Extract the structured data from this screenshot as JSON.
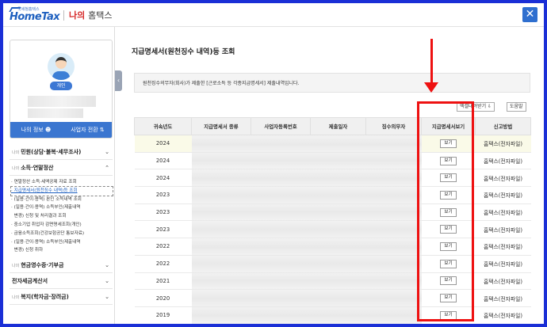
{
  "header": {
    "logo_small": "국세청홈택스",
    "logo_text": "HomeTax",
    "brand_red": "나의",
    "brand_dark": "홈택스",
    "close_symbol": "✕"
  },
  "profile": {
    "badge": "개인",
    "my_info": "나의 정보",
    "switch_btn": "사업자 전환"
  },
  "menu": {
    "sections": [
      {
        "prefix": "나의",
        "label": "민원(상담·불복·세무조사)"
      },
      {
        "prefix": "나의",
        "label": "소득·연말정산"
      },
      {
        "prefix": "나의",
        "label": "현금영수증·기부금"
      },
      {
        "prefix": "",
        "label": "전자세금계산서"
      },
      {
        "prefix": "나의",
        "label": "복지(학자금·장려금)"
      }
    ],
    "subitems": [
      "연말정산 소득·세액공제 자료 조회",
      "지급명세서(원천징수 내역)등 조회",
      "(일용·간이·용역) 본인 소득내역 조회",
      "(일용·간이·용역) 소득부인(제출내역",
      "변경) 신청 및 처리결과 조회",
      "중소기업 취업자 감면명세조회(개인)",
      "금융소득조회(건강보험공단 통보자료)",
      "(일용·간이·용역) 소득부인(제출내역",
      "변경) 신청 취하"
    ]
  },
  "main": {
    "title": "지급명세서(원천징수 내역)등 조회",
    "info": "원천징수의무자(회사)가 제출한 [근로소득 등 각종지급명세서] 제출내역입니다.",
    "tool_print": "엑셀내려받기",
    "tool_help": "도움말"
  },
  "table": {
    "headers": [
      "귀속년도",
      "지급명세서 종류",
      "사업자등록번호",
      "제출일자",
      "징수의무자",
      "지급명세서보기",
      "신고방법"
    ],
    "view_label": "보기",
    "rows": [
      {
        "year": "2024",
        "method": "홈택스(전자파일)"
      },
      {
        "year": "2024",
        "method": "홈택스(전자파일)"
      },
      {
        "year": "2024",
        "method": "홈택스(전자파일)"
      },
      {
        "year": "2023",
        "method": "홈택스(전자파일)"
      },
      {
        "year": "2023",
        "method": "홈택스(전자파일)"
      },
      {
        "year": "2023",
        "method": "홈택스(전자파일)"
      },
      {
        "year": "2022",
        "method": "홈택스(전자파일)"
      },
      {
        "year": "2022",
        "method": "홈택스(전자파일)"
      },
      {
        "year": "2021",
        "method": "홈택스(전자파일)"
      },
      {
        "year": "2020",
        "method": "홈택스(전자파일)"
      },
      {
        "year": "2019",
        "method": "홈택스(전자파일)"
      }
    ]
  },
  "colors": {
    "accent": "#1d5fbf",
    "highlight": "#e11111",
    "frame": "#1a2fd6"
  }
}
